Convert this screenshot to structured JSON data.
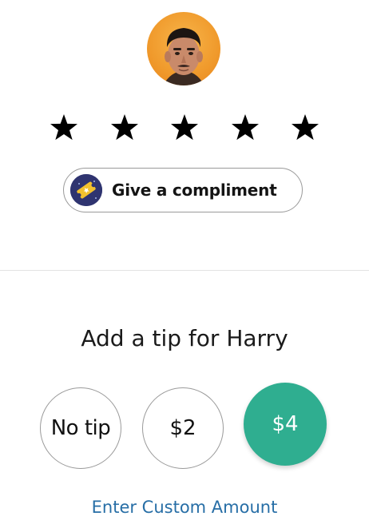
{
  "rating": {
    "max_stars": 5,
    "selected_stars": 5,
    "star_icon": "star-icon"
  },
  "compliment": {
    "label": "Give a compliment",
    "icon": "compliment-ticket-icon"
  },
  "tip": {
    "heading": "Add a tip for Harry",
    "options": [
      {
        "label": "No tip",
        "selected": false
      },
      {
        "label": "$2",
        "selected": false
      },
      {
        "label": "$4",
        "selected": true
      }
    ],
    "custom_amount_label": "Enter Custom Amount"
  },
  "colors": {
    "accent_green": "#2fae90",
    "link_blue": "#276ea6",
    "star_black": "#000000",
    "compliment_icon_bg": "#2f3470",
    "compliment_ticket": "#f2c12e"
  }
}
